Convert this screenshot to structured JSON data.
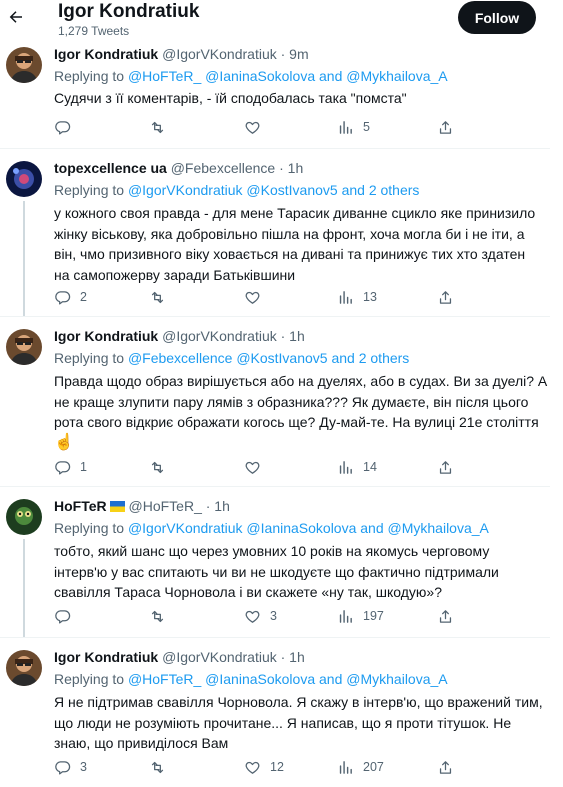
{
  "header": {
    "name": "Igor Kondratiuk",
    "tweet_count": "1,279 Tweets",
    "follow_label": "Follow"
  },
  "tweets": [
    {
      "name": "Igor Kondratiuk",
      "handle": "@IgorVKondratiuk",
      "time": "· 9m",
      "replying_prefix": "Replying to ",
      "replying_rest": "@HoFTeR_ @IaninaSokolova and @Mykhailova_A",
      "lines": [
        "Судячи з її коментарів, - їй сподобалась така \"помста\""
      ],
      "replies": "",
      "retweets": "",
      "likes": "",
      "views": "5"
    },
    {
      "name": "topexcellence ua",
      "handle": "@Febexcellence",
      "time": "· 1h",
      "replying_prefix": "Replying to ",
      "replying_rest": "@IgorVKondratiuk @KostIvanov5 and 2 others",
      "lines": [
        "у кожного своя правда - для мене Тарасик диванне сцикло яке принизило",
        "жінку віськову, яка добровільно пішла на фронт, хоча могла би і не іти, а",
        "він, чмо призивного віку ховається на дивані та принижує тих хто здатен",
        "на самопожерву заради Батьківшини"
      ],
      "replies": "2",
      "retweets": "",
      "likes": "",
      "views": "13"
    },
    {
      "name": "Igor Kondratiuk",
      "handle": "@IgorVKondratiuk",
      "time": "· 1h",
      "replying_prefix": "Replying to ",
      "replying_rest": "@Febexcellence @KostIvanov5 and 2 others",
      "lines": [
        "Правда щодо образ вирішується або на дуелях, або в судах. Ви за дуелі? А",
        "не краще злупити пару лямів з образника??? Як думаєте, він після цього",
        "рота свого відкриє ображати когось ще? Ду-май-те. На вулиці 21е століття"
      ],
      "emoji": "☝",
      "replies": "1",
      "retweets": "",
      "likes": "",
      "views": "14"
    },
    {
      "name": "HoFTeR",
      "handle": "@HoFTeR_",
      "time": "· 1h",
      "replying_prefix": "Replying to ",
      "replying_rest": "@IgorVKondratiuk @IaninaSokolova and @Mykhailova_A",
      "lines": [
        "тобто, який шанс що через умовних 10 років на якомусь черговому",
        "інтерв'ю у вас спитають чи ви не шкодуєте що фактично підтримали",
        "свавілля Тараса Чорновола і ви скажете «ну так, шкодую»?"
      ],
      "replies": "",
      "retweets": "",
      "likes": "3",
      "views": "197"
    },
    {
      "name": "Igor Kondratiuk",
      "handle": "@IgorVKondratiuk",
      "time": "· 1h",
      "replying_prefix": "Replying to ",
      "replying_rest": "@HoFTeR_ @IaninaSokolova and @Mykhailova_A",
      "lines": [
        "Я не підтримав свавілля Чорновола. Я скажу в інтерв'ю, що вражений тим,",
        "що люди не розуміють прочитане... Я написав, що я проти тітушок. Не",
        "знаю, що привиділося Вам"
      ],
      "replies": "3",
      "retweets": "",
      "likes": "12",
      "views": "207"
    }
  ],
  "icons": {
    "back": "arrow-left-icon",
    "reply": "reply-icon",
    "retweet": "retweet-icon",
    "like": "heart-icon",
    "views": "views-icon",
    "share": "share-icon",
    "flag": "ukraine-flag-icon",
    "emoji": "pointing-up-icon"
  },
  "colors": {
    "link": "#1d9bf0",
    "muted": "#536471",
    "text": "#0f1419",
    "follow_bg": "#0f1419",
    "flag_blue": "#1f6fd0",
    "flag_yellow": "#f7d117"
  }
}
